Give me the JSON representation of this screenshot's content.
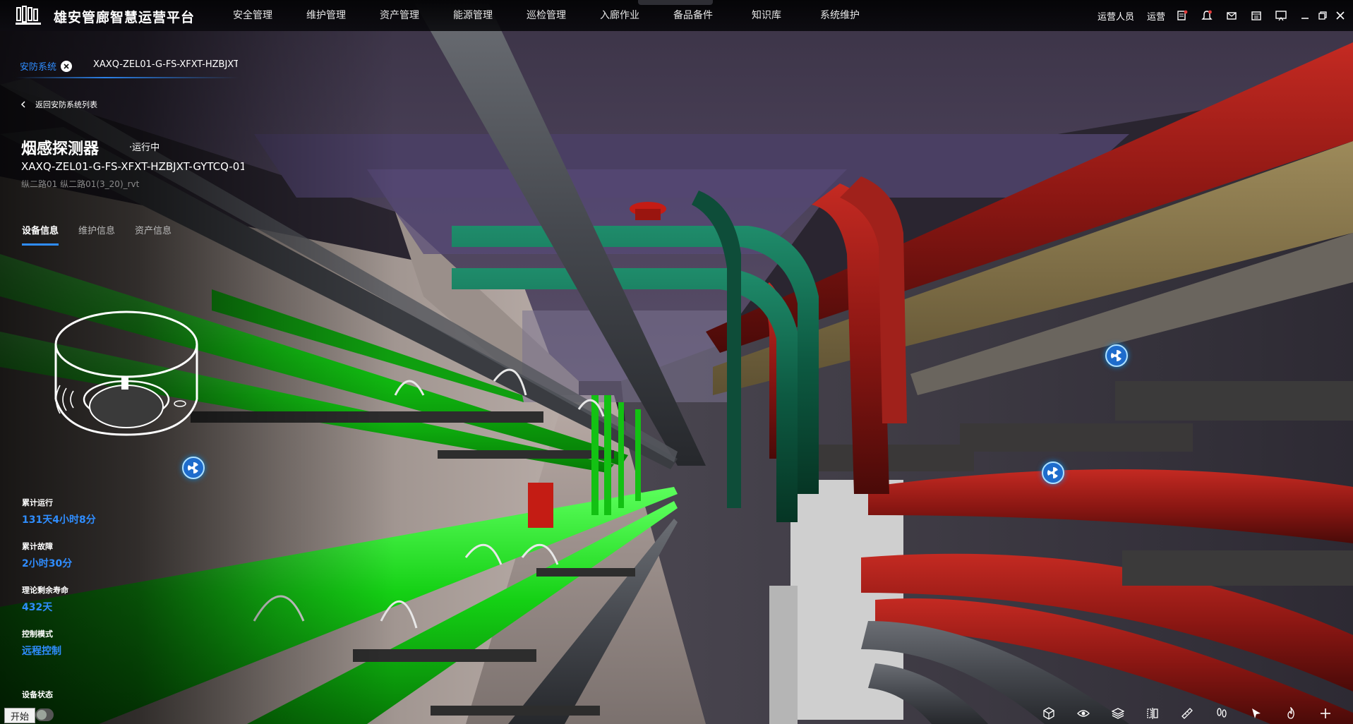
{
  "header": {
    "app_title": "雄安管廊智慧运营平台",
    "nav": [
      "安全管理",
      "维护管理",
      "资产管理",
      "能源管理",
      "巡检管理",
      "入廊作业",
      "备品备件",
      "知识库",
      "系统维护"
    ],
    "user_name": "运营人员",
    "user_role": "运营",
    "icons": [
      "report-icon",
      "bell-icon",
      "mail-icon",
      "calendar-icon",
      "screen-icon"
    ],
    "window_controls": [
      "minimize-icon",
      "restore-icon",
      "close-icon"
    ]
  },
  "panel": {
    "tab_label": "安防系统",
    "tab_code": "XAXQ-ZEL01-G-FS-XFXT-HZBJXT",
    "back_label": "返回安防系统列表",
    "device_name": "烟感探测器",
    "status": "·运行中",
    "device_code": "XAXQ-ZEL01-G-FS-XFXT-HZBJXT-GYTCQ-01",
    "location": "纵二路01  纵二路01(3_20)_rvt",
    "tabs": [
      "设备信息",
      "维护信息",
      "资产信息"
    ],
    "active_tab": 0,
    "metrics": [
      {
        "label": "累计运行",
        "value": "131天4小时8分"
      },
      {
        "label": "累计故障",
        "value": "2小时30分"
      },
      {
        "label": "理论剩余寿命",
        "value": "432天"
      },
      {
        "label": "控制模式",
        "value": "远程控制"
      },
      {
        "label": "设备状态",
        "value": ""
      }
    ]
  },
  "taskbar": {
    "start_label": "开始"
  },
  "toolbar": {
    "icons": [
      "cube-icon",
      "eye-icon",
      "layers-icon",
      "split-icon",
      "ruler-icon",
      "footprint-icon",
      "pointer-icon",
      "fire-icon",
      "plus-icon"
    ]
  },
  "colors": {
    "accent": "#2f8dff",
    "pipe_green": "#11d11a",
    "pipe_red": "#8f1a16",
    "pipe_teal": "#0f5e45",
    "marker": "#1e6ccc"
  }
}
